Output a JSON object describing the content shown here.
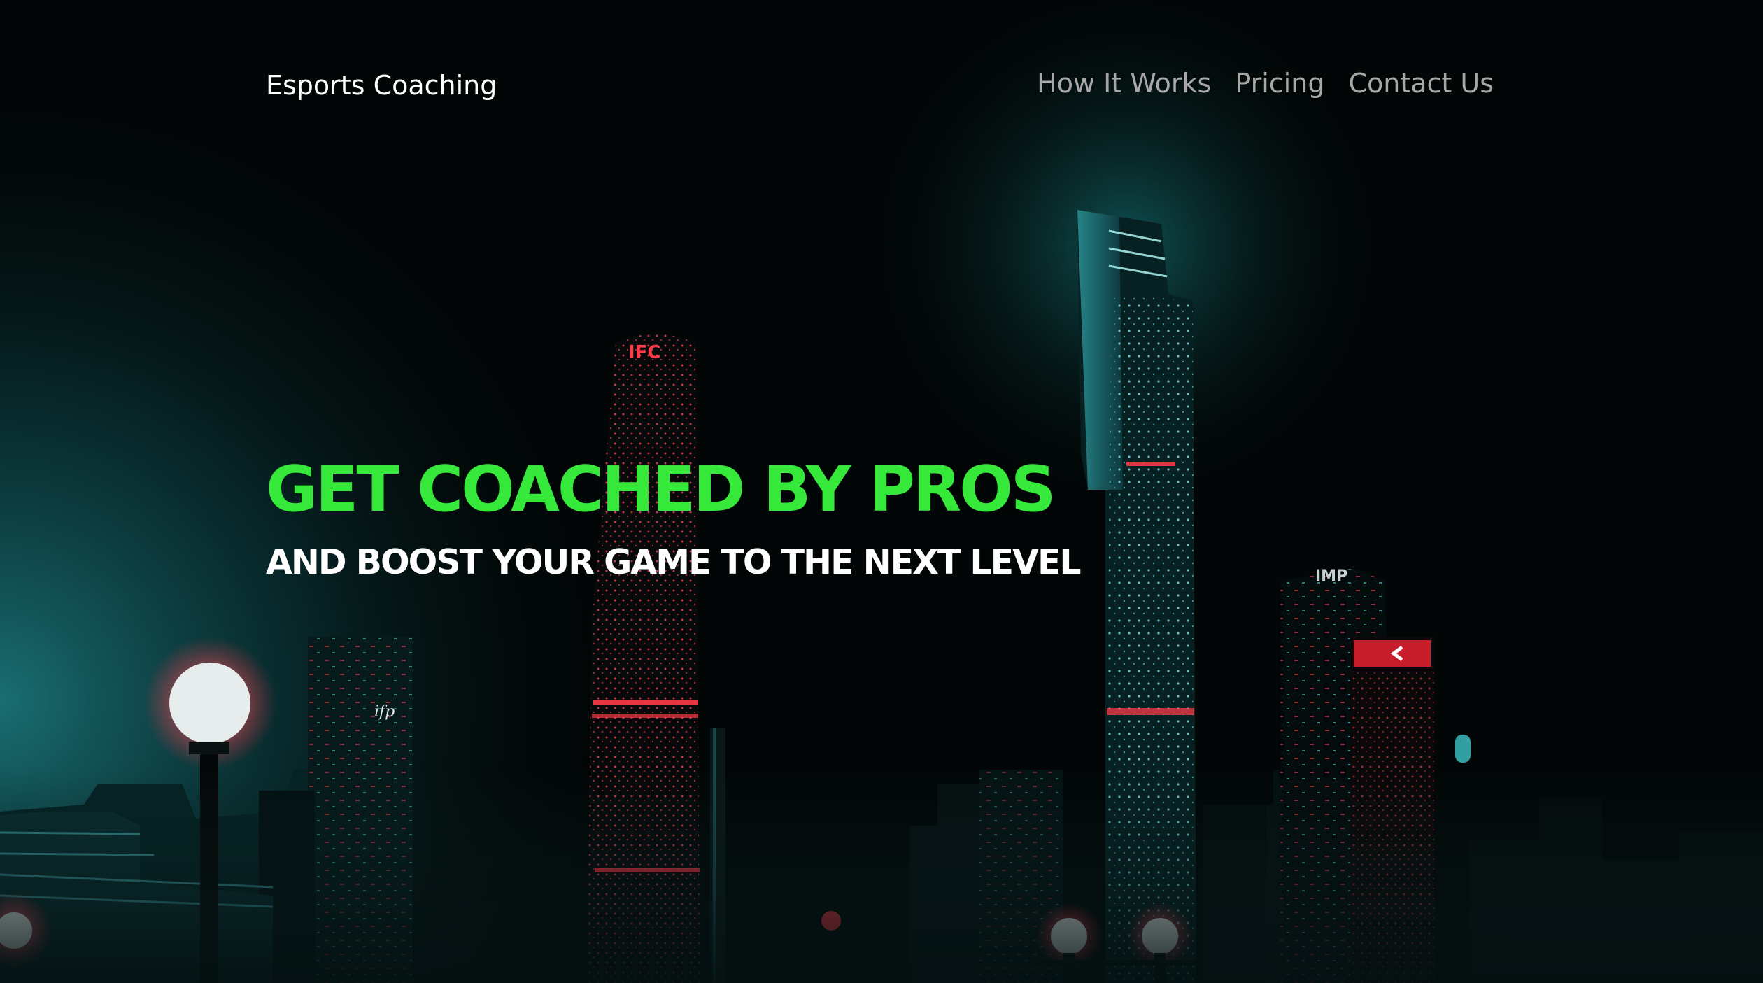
{
  "header": {
    "brand": "Esports Coaching",
    "nav": [
      {
        "label": "How It Works"
      },
      {
        "label": "Pricing"
      },
      {
        "label": "Contact Us"
      }
    ]
  },
  "hero": {
    "title": "GET COACHED BY PROS",
    "subtitle": "AND BOOST YOUR GAME TO THE NEXT LEVEL"
  },
  "background": {
    "signs": [
      "IFC",
      "IMP",
      "ifp"
    ]
  },
  "colors": {
    "accent": "#35e83a",
    "text": "#ffffff",
    "nav_text": "#a8a8a8",
    "background": "#020606"
  }
}
